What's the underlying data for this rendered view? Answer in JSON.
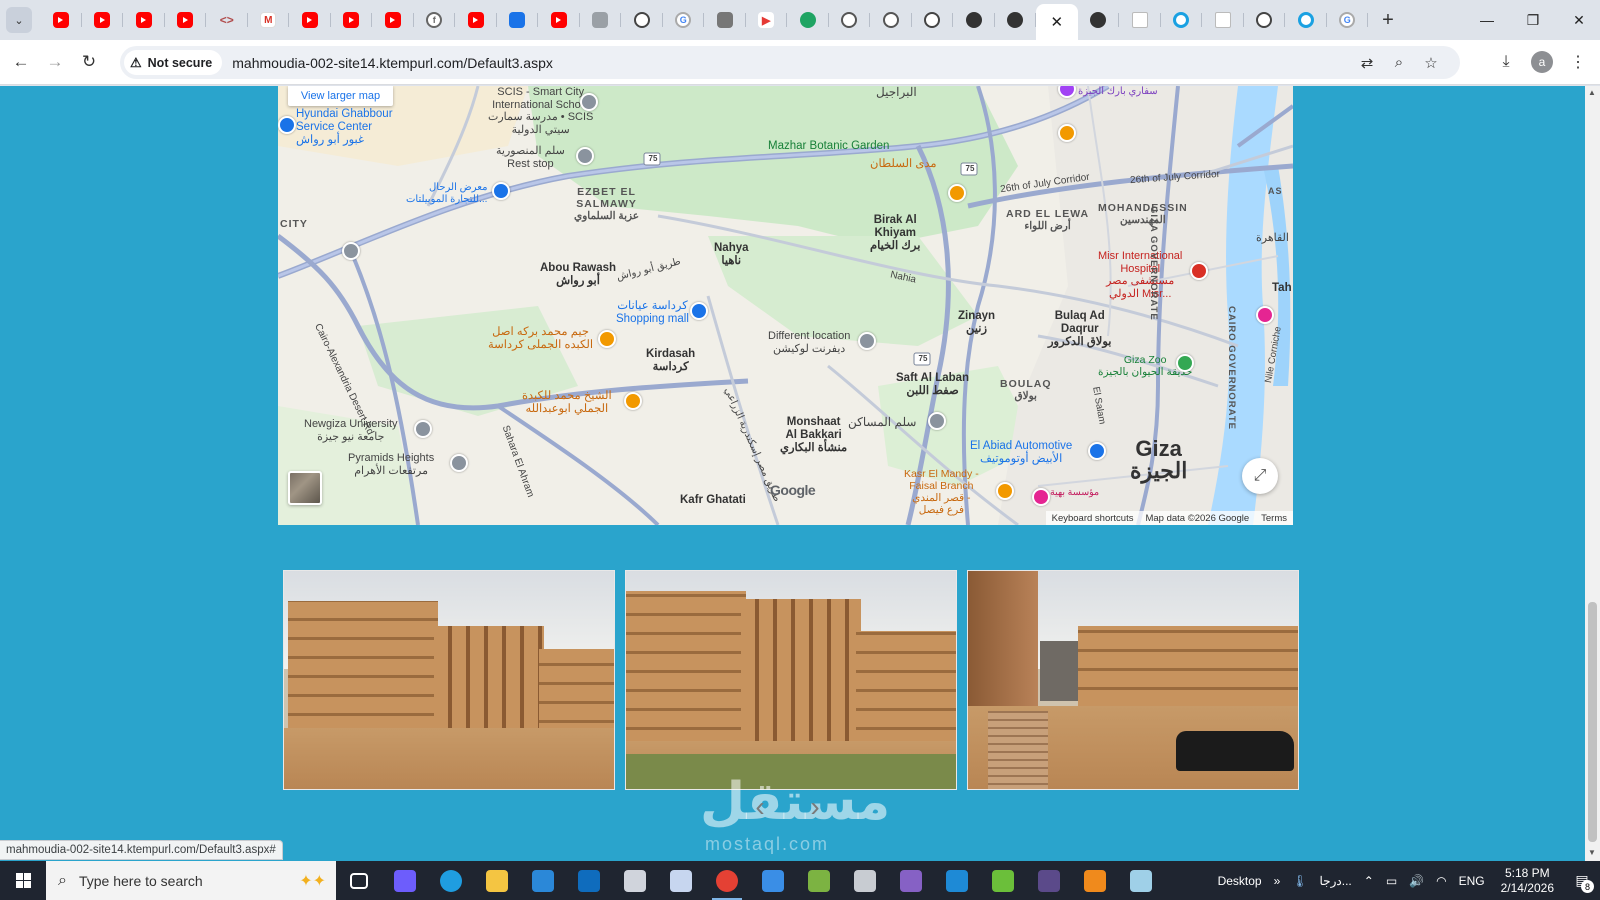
{
  "browser": {
    "tabs": [
      {
        "icon": "youtube-icon"
      },
      {
        "icon": "youtube-icon"
      },
      {
        "icon": "youtube-icon"
      },
      {
        "icon": "youtube-icon"
      },
      {
        "icon": "code-icon"
      },
      {
        "icon": "gmail-icon"
      },
      {
        "icon": "youtube-icon"
      },
      {
        "icon": "youtube-icon"
      },
      {
        "icon": "youtube-icon"
      },
      {
        "icon": "facebook-icon"
      },
      {
        "icon": "youtube-icon"
      },
      {
        "icon": "flag-icon"
      },
      {
        "icon": "youtube-icon"
      },
      {
        "icon": "video-icon"
      },
      {
        "icon": "openai-icon"
      },
      {
        "icon": "google-icon"
      },
      {
        "icon": "grid-icon"
      },
      {
        "icon": "play-icon"
      },
      {
        "icon": "green-circle-icon"
      },
      {
        "icon": "globe-icon"
      },
      {
        "icon": "globe-icon"
      },
      {
        "icon": "openai-icon"
      },
      {
        "icon": "dark-swirl-icon"
      },
      {
        "icon": "dark-swirl-icon"
      },
      {
        "icon": "close-icon",
        "active": true
      },
      {
        "icon": "dark-swirl-icon"
      },
      {
        "icon": "document-icon"
      },
      {
        "icon": "circle-icon"
      },
      {
        "icon": "document-icon"
      },
      {
        "icon": "openai-icon"
      },
      {
        "icon": "circle-icon"
      },
      {
        "icon": "google-icon"
      }
    ],
    "close_glyph": "✕",
    "new_tab_glyph": "+",
    "security_label": "Not secure",
    "url": "mahmoudia-002-site14.ktempurl.com/Default3.aspx",
    "avatar_initial": "a",
    "status_url": "mahmoudia-002-site14.ktempurl.com/Default3.aspx#"
  },
  "map": {
    "view_larger": "View larger map",
    "footer": {
      "shortcuts": "Keyboard shortcuts",
      "map_data": "Map data ©2026 Google",
      "terms": "Terms"
    },
    "logo": "Google",
    "labels": {
      "scis": "SCIS - Smart City\nInternational School\nمدرسة سمارت • SCIS\nسيتي الدولية",
      "hyundai": "Hyundai Ghabbour\nService Center\nغبور أبو رواش",
      "mansouria": "سلم المنصورية\nRest stop",
      "rehab": "معرض الرحال\nللتجارة الموبيلتات...",
      "ezbet": "EZBET EL\nSALMAWY\nعزبة السلماوي",
      "mazhar": "Mazhar Botanic Garden",
      "sultan": "مدى السلطان",
      "birak": "Birak Al\nKhiyam\nبرك الخيام",
      "ardlewa": "ARD EL LEWA\nأرض اللواء",
      "mohandessin": "MOHANDESSIN\nالمهندسين",
      "july26a": "26th of July Corridor",
      "july26b": "26th of July Corridor",
      "nahya": "Nahya\nناهيا",
      "abourawash": "Abou Rawash\nأبو رواش",
      "city": "CITY",
      "kardasa_mall": "كرداسة عيانات\nShopping mall",
      "gym": "جيم محمد بركه اصل\nالكبده الجملى كرداسة",
      "kirdasah": "Kirdasah\nكرداسة",
      "different": "Different location\nديفرنت لوكيشن",
      "misr_hospital": "Misr International\nHospital\nمستشفى مصر\nالدولي Misr...",
      "zinayn": "Zinayn\nزنين",
      "bulaq": "Bulaq Ad\nDaqrur\nبولاق الدكرور",
      "gizazoo": "Giza Zoo\nحديقة الحيوان بالجيزة",
      "sheikh": "الشيخ محمد للكبدة\nالجملي ابوعبدالله",
      "saftlaban": "Saft Al Laban\nصفط اللبن",
      "boulaq": "BOULAQ\nبولاق",
      "newgiza": "Newgiza University\nجامعة نيو جيزة",
      "monshaat": "Monshaat\nAl Bakkari\nمنشأة البكاري",
      "masaken": "سلم المساكن",
      "abiad": "El Abiad Automotive\nالأبيض أوتوموتيف",
      "pyramids": "Pyramids Heights\nمرتفعات الأهرام",
      "giza": "Giza\nالجيزة",
      "kasr": "Kasr El Mandy -\nFaisal Branch\nقصر المندي -\nفرع فيصل",
      "kafr": "Kafr Ghatati",
      "mahtet": "مؤسسة بهية",
      "baragel": "البراجيل",
      "safari": "سفاري بارك الجيزة",
      "giza_gov": "GIZA GOVERNORATE",
      "cairo_gov": "CAIRO GOVERNORATE",
      "cairo": "القاهرة",
      "tah": "Tah",
      "nahia_road": "Nahia",
      "abou_road": "طريق أبو رواش",
      "cairo_alex": "Cairo-Alexandria Desert Rd",
      "sahara": "Sahara El Ahram",
      "misr_road": "طريق مصر إسكندرية الزراعي",
      "nile": "Nile Corniche",
      "salam": "El Salam",
      "as": "AS",
      "r75a": "75",
      "r75b": "75",
      "r75c": "75"
    }
  },
  "gallery": {
    "prev_glyph": "‹",
    "next_glyph": "›",
    "watermark": "مستقل",
    "watermark_sub": "mostaql.com"
  },
  "taskbar": {
    "search_placeholder": "Type here to search",
    "desktop_label": "Desktop",
    "weather_label": "درجا...",
    "language": "ENG",
    "time": "5:18 PM",
    "date": "2/14/2026",
    "notification_count": "8",
    "chevron": "»",
    "apps": [
      {
        "name": "task-view-icon",
        "color": "#ffffff"
      },
      {
        "name": "copilot-icon",
        "color": "#6d5dfc"
      },
      {
        "name": "edge-icon",
        "color": "#1f9de0"
      },
      {
        "name": "file-explorer-icon",
        "color": "#f4c542"
      },
      {
        "name": "store-icon",
        "color": "#2b88d8"
      },
      {
        "name": "outlook-icon",
        "color": "#0f6cbd"
      },
      {
        "name": "paint-icon",
        "color": "#d0d4dc"
      },
      {
        "name": "chart-app-icon",
        "color": "#c7d6ef"
      },
      {
        "name": "chrome-icon",
        "color": "#e44134",
        "active": true
      },
      {
        "name": "photos-icon",
        "color": "#3a8ee6"
      },
      {
        "name": "draw-app-icon",
        "color": "#7cb342"
      },
      {
        "name": "settings-icon",
        "color": "#c8ccd2"
      },
      {
        "name": "visual-studio-icon",
        "color": "#8661c5"
      },
      {
        "name": "vscode-icon",
        "color": "#1e8ad6"
      },
      {
        "name": "download-app-icon",
        "color": "#6bbf3a"
      },
      {
        "name": "terminal-icon",
        "color": "#5b4a8a"
      },
      {
        "name": "vlc-icon",
        "color": "#f08a1c"
      },
      {
        "name": "notes-app-icon",
        "color": "#9fd0e8"
      }
    ]
  }
}
